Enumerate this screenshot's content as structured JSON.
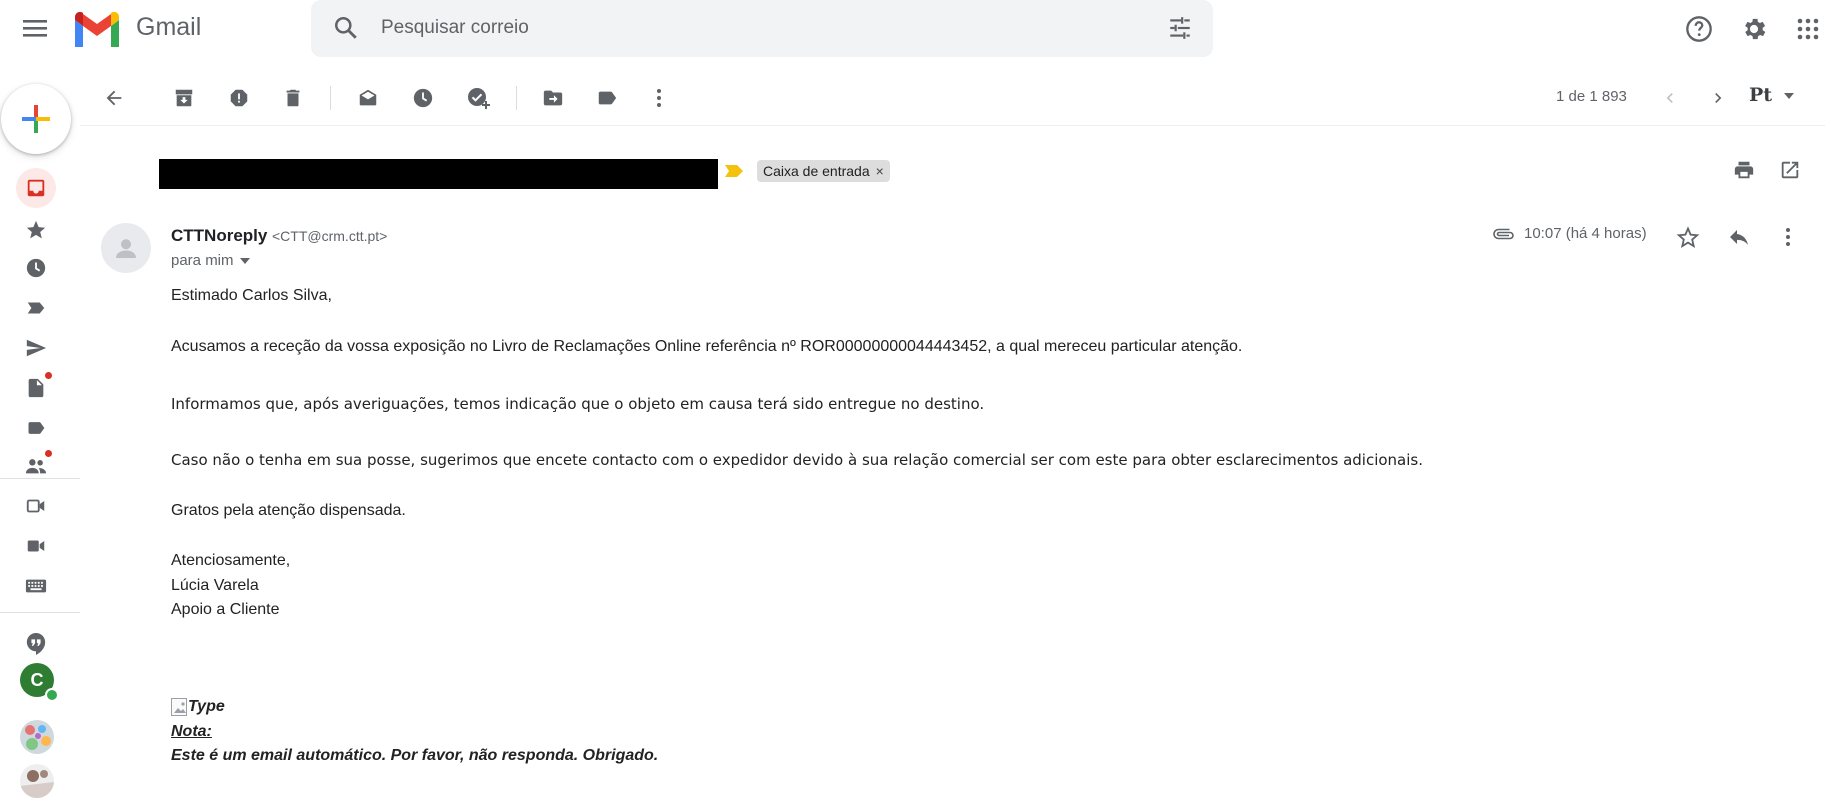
{
  "app": {
    "name": "Gmail"
  },
  "search": {
    "placeholder": "Pesquisar correio"
  },
  "toolbar": {
    "pager_text": "1 de 1 893",
    "language_button": "Pt"
  },
  "subject": {
    "label_chip": "Caixa de entrada",
    "chip_remove": "×"
  },
  "message": {
    "sender_name": "CTTNoreply",
    "sender_email": "<CTT@crm.ctt.pt>",
    "recipient": "para mim",
    "time": "10:07 (há 4 horas)",
    "body": {
      "greeting": "Estimado Carlos Silva,",
      "para1": "Acusamos a receção da vossa exposição no Livro de Reclamações Online referência nº ROR00000000044443452, a qual mereceu particular atenção.",
      "para2": "Informamos que, após averiguações, temos indicação que o objeto em causa terá sido entregue no destino.",
      "para3": "Caso não o tenha em sua posse, sugerimos que encete contacto com o expedidor devido à sua relação comercial ser com este para obter esclarecimentos adicionais.",
      "para4": "Gratos pela atenção dispensada.",
      "signoff": "Atenciosamente,",
      "signature_name": "Lúcia Varela",
      "signature_dept": "Apoio a Cliente",
      "image_alt": "Type",
      "note_label": "Nota:",
      "note_text": "Este é um email automático. Por favor, não responda. Obrigado."
    }
  },
  "rail": {
    "avatar_letter": "C"
  },
  "colors": {
    "accent_red": "#d93025",
    "inbox_active_bg": "#fce8e6",
    "search_bg": "#f1f3f4",
    "online_green": "#34a853",
    "importance_yellow": "#f4c20d"
  }
}
